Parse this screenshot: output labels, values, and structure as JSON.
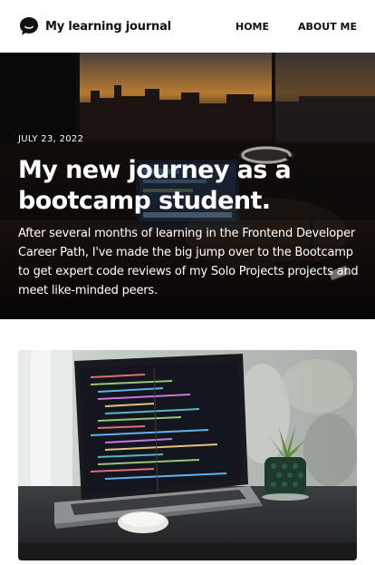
{
  "header": {
    "brand_name": "My learning journal",
    "nav": [
      {
        "label": "HOME"
      },
      {
        "label": "ABOUT ME"
      }
    ]
  },
  "hero": {
    "date": "JULY 23, 2022",
    "title": "My new journey as a bootcamp student.",
    "description": "After several months of learning in the Frontend Developer Career Path, I've made the big jump over to the Bootcamp to get expert code reviews of my Solo Projects projects and meet like-minded peers."
  },
  "colors": {
    "header_bg": "#ffffff",
    "hero_text": "#ffffff",
    "page_bg": "#ffffff"
  },
  "icons": {
    "brand": "chat-bubble-smile-icon"
  }
}
